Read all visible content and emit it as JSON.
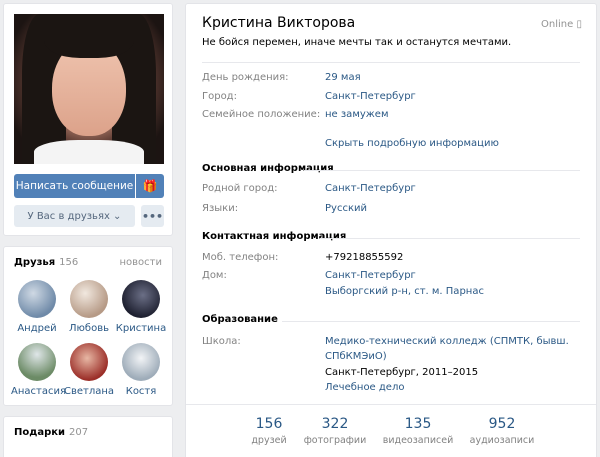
{
  "profile": {
    "name": "Кристина Викторова",
    "online": "Online",
    "status": "Не бойся перемен, иначе мечты так и останутся мечтами.",
    "birthday_label": "День рождения:",
    "birthday": "29 мая",
    "city_label": "Город:",
    "city": "Санкт-Петербург",
    "family_label": "Семейное положение:",
    "family": "не замужем",
    "show_more": "Скрыть подробную информацию"
  },
  "main_info": {
    "title": "Основная информация",
    "hometown_label": "Родной город:",
    "hometown": "Санкт-Петербург",
    "languages_label": "Языки:",
    "languages": "Русский"
  },
  "contact_info": {
    "title": "Контактная информация",
    "phone_label": "Моб. телефон:",
    "phone": "+79218855592",
    "home_label": "Дом:",
    "home_city": "Санкт-Петербург",
    "home_district": "Выборгский р-н, ст. м. Парнас"
  },
  "education": {
    "title": "Образование",
    "school_label": "Школа:",
    "school_line1": "Медико-технический колледж (СПМТК, бывш.",
    "school_line2": "СПбКМЭиО)",
    "school_city_years": "Санкт-Петербург, 2011–2015",
    "speciality": "Лечебное дело"
  },
  "counters": [
    {
      "num": "156",
      "label": "друзей"
    },
    {
      "num": "322",
      "label": "фотографии"
    },
    {
      "num": "135",
      "label": "видеозаписей"
    },
    {
      "num": "952",
      "label": "аудиозаписи"
    }
  ],
  "actions": {
    "write_message": "Написать сообщение",
    "gift_icon": "gift-icon",
    "in_friends": "У Вас в друзьях ⌄",
    "more": "•••"
  },
  "friends": {
    "title": "Друзья",
    "count": "156",
    "news": "новости",
    "list": [
      {
        "name": "Андрей",
        "color": "#8aa4c0"
      },
      {
        "name": "Любовь",
        "color": "#c9b8a8"
      },
      {
        "name": "Кristina",
        "color": "#2d3040"
      },
      {
        "name": "Анастасия",
        "color": "#7e9a7a"
      },
      {
        "name": "Светлана",
        "color": "#a63a32"
      },
      {
        "name": "Костя",
        "color": "#b8c4cf"
      }
    ]
  },
  "gifts": {
    "title": "Подарки",
    "count": "207"
  },
  "colors": {
    "accent": "#5181b8",
    "link": "#2a5885",
    "muted": "#828282",
    "background": "#edeef0"
  }
}
